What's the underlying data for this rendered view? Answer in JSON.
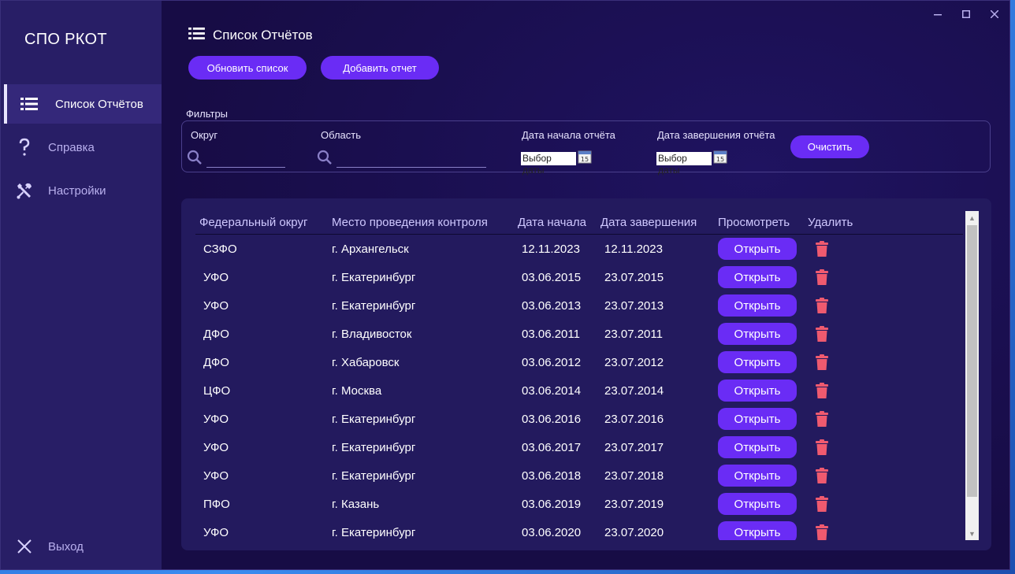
{
  "app": {
    "title": "СПО РКОТ"
  },
  "sidebar": {
    "items": [
      {
        "label": "Список Отчётов",
        "icon": "list-icon"
      },
      {
        "label": "Справка",
        "icon": "question-icon"
      },
      {
        "label": "Настройки",
        "icon": "tools-icon"
      }
    ],
    "exit": {
      "label": "Выход",
      "icon": "close-icon"
    }
  },
  "header": {
    "title": "Список Отчётов"
  },
  "toolbar": {
    "refresh_label": "Обновить список",
    "add_label": "Добавить отчет"
  },
  "filters": {
    "title": "Фильтры",
    "district_label": "Округ",
    "district_value": "",
    "region_label": "Область",
    "region_value": "",
    "start_label": "Дата начала отчёта",
    "start_placeholder": "Выбор даты",
    "end_label": "Дата завершения отчёта",
    "end_placeholder": "Выбор даты",
    "clear_label": "Очистить"
  },
  "table": {
    "columns": [
      "Федеральный округ",
      "Место проведения контроля",
      "Дата начала",
      "Дата завершения",
      "Просмотреть",
      "Удалить"
    ],
    "open_label": "Открыть",
    "rows": [
      {
        "district": "СЗФО",
        "place": "г. Архангельск",
        "start": "12.11.2023",
        "end": "12.11.2023"
      },
      {
        "district": "УФО",
        "place": "г. Екатеринбург",
        "start": "03.06.2015",
        "end": "23.07.2015"
      },
      {
        "district": "УФО",
        "place": "г. Екатеринбург",
        "start": "03.06.2013",
        "end": "23.07.2013"
      },
      {
        "district": "ДФО",
        "place": "г. Владивосток",
        "start": "03.06.2011",
        "end": "23.07.2011"
      },
      {
        "district": "ДФО",
        "place": "г. Хабаровск",
        "start": "03.06.2012",
        "end": "23.07.2012"
      },
      {
        "district": "ЦФО",
        "place": "г. Москва",
        "start": "03.06.2014",
        "end": "23.07.2014"
      },
      {
        "district": "УФО",
        "place": "г. Екатеринбург",
        "start": "03.06.2016",
        "end": "23.07.2016"
      },
      {
        "district": "УФО",
        "place": "г. Екатеринбург",
        "start": "03.06.2017",
        "end": "23.07.2017"
      },
      {
        "district": "УФО",
        "place": "г. Екатеринбург",
        "start": "03.06.2018",
        "end": "23.07.2018"
      },
      {
        "district": "ПФО",
        "place": "г. Казань",
        "start": "03.06.2019",
        "end": "23.07.2019"
      },
      {
        "district": "УФО",
        "place": "г. Екатеринбург",
        "start": "03.06.2020",
        "end": "23.07.2020"
      }
    ]
  },
  "colors": {
    "accent": "#6a2cf5",
    "sidebar": "#281e66",
    "background": "#170c45",
    "danger": "#ef5a6f"
  }
}
